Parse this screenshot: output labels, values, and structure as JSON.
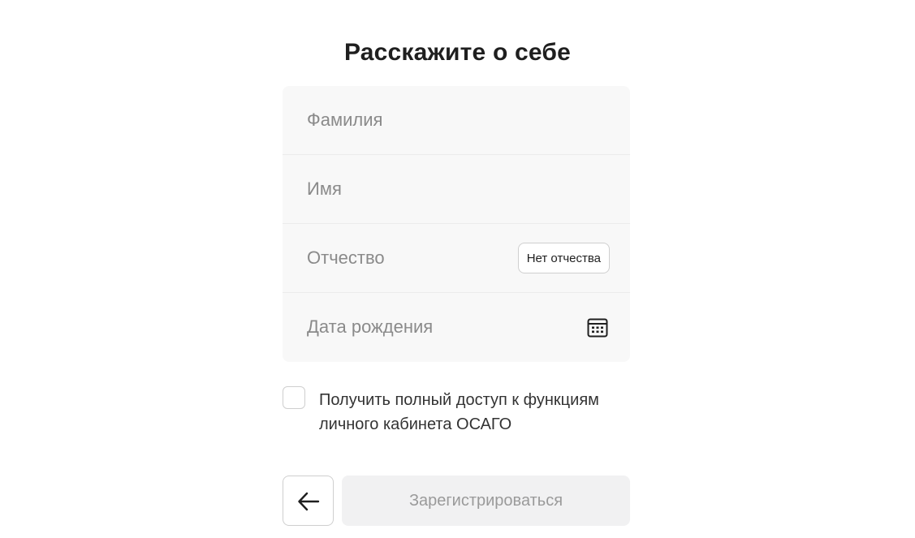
{
  "header": {
    "title": "Расскажите о себе"
  },
  "form": {
    "last_name": {
      "placeholder": "Фамилия",
      "value": ""
    },
    "first_name": {
      "placeholder": "Имя",
      "value": ""
    },
    "patronymic": {
      "placeholder": "Отчество",
      "value": "",
      "no_patronymic_label": "Нет отчества"
    },
    "birth_date": {
      "placeholder": "Дата рождения",
      "value": "",
      "icon": "calendar-icon"
    }
  },
  "consent": {
    "checked": false,
    "label": "Получить полный доступ к функциям личного кабинета ОСАГО"
  },
  "actions": {
    "back_icon": "arrow-left-icon",
    "submit_label": "Зарегистрироваться",
    "submit_disabled": true
  },
  "colors": {
    "card_background": "#f8f8f8",
    "placeholder": "#8a8a8a",
    "submit_disabled_bg": "#f1f1f2",
    "submit_disabled_text": "#9a9a9a"
  }
}
